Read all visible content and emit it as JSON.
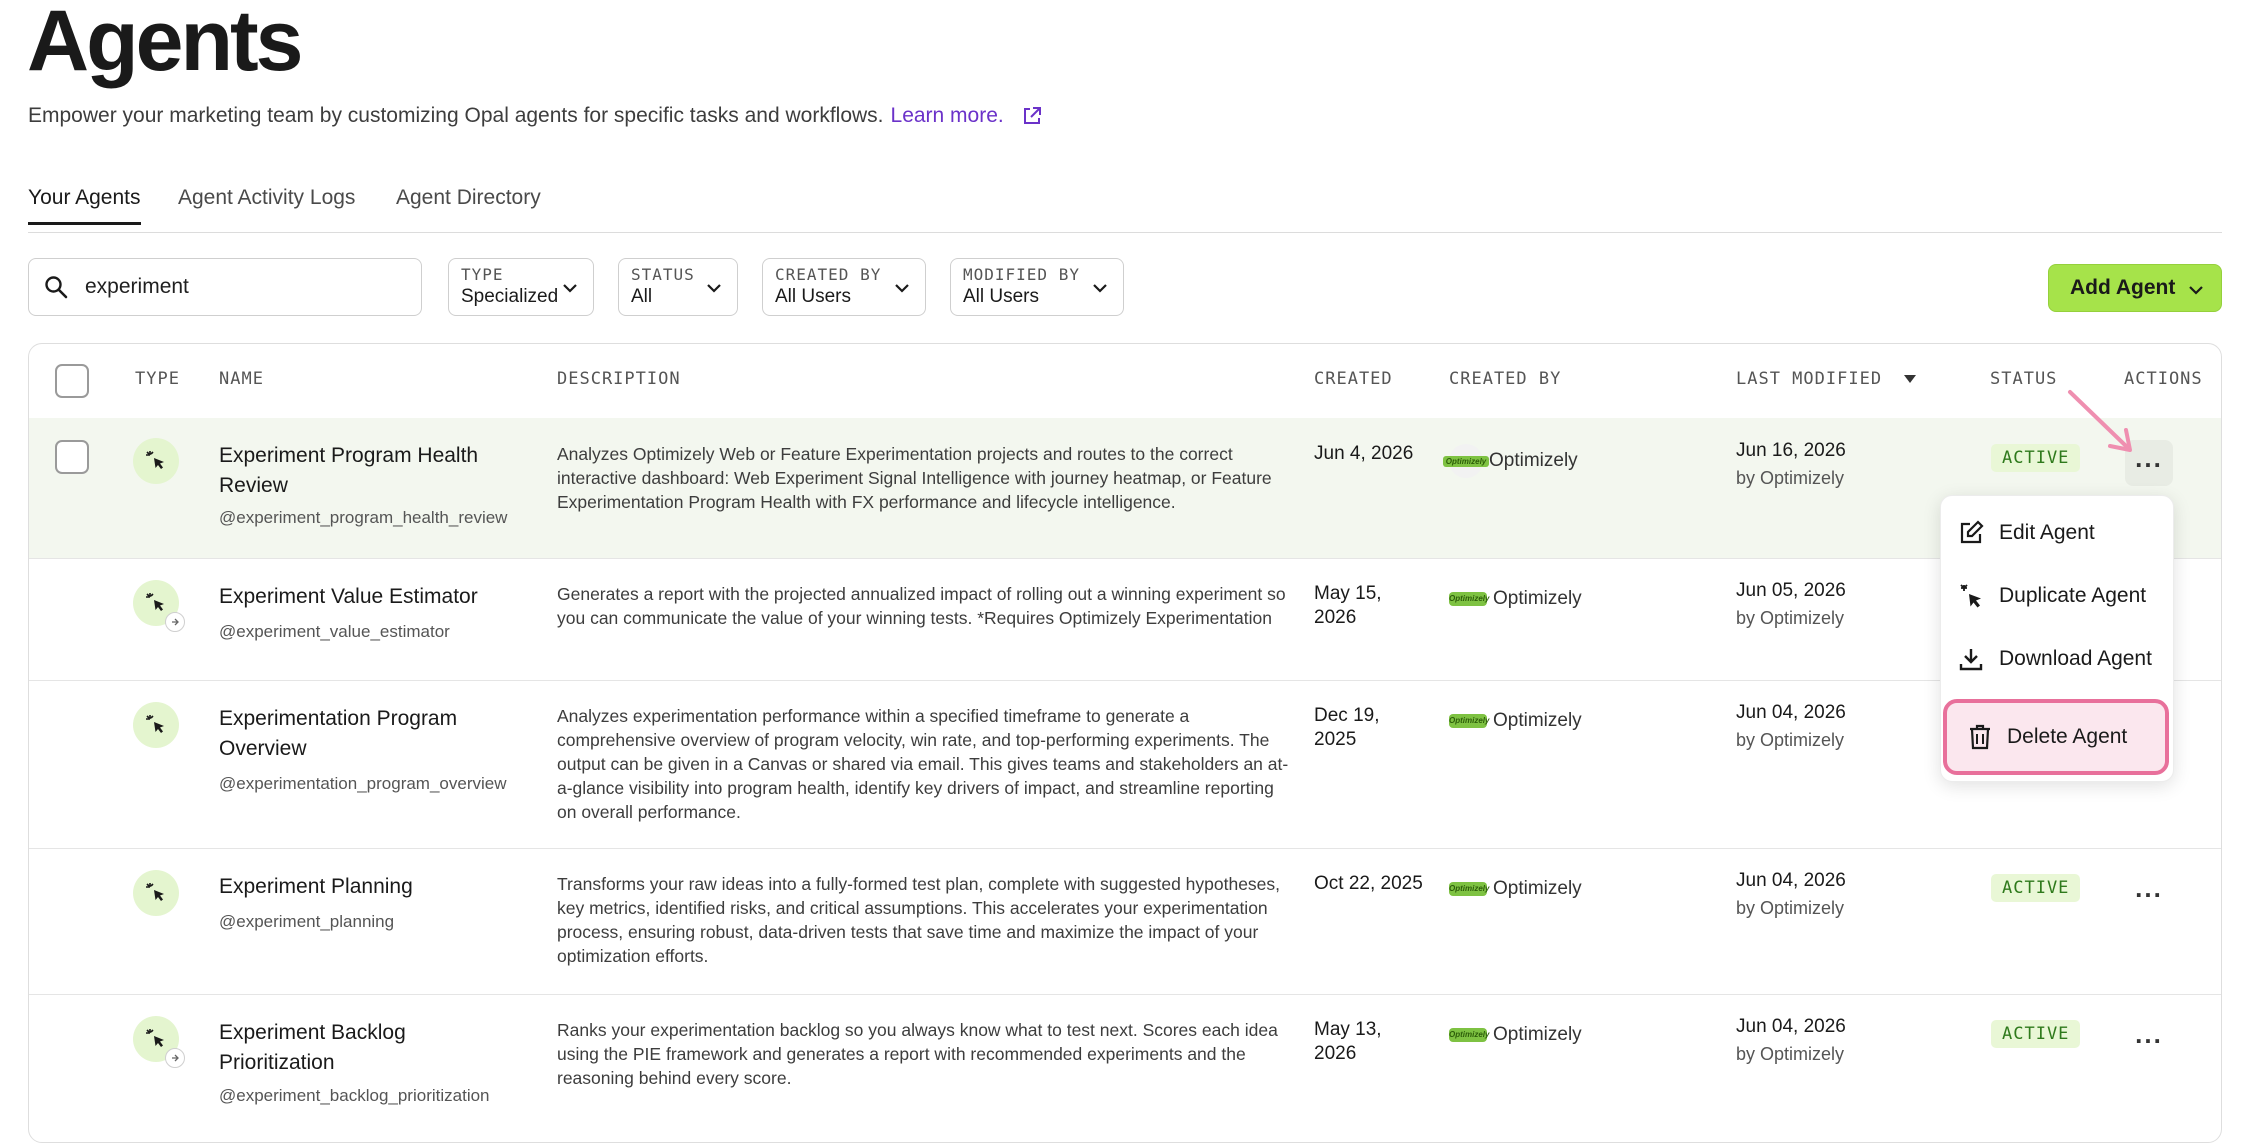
{
  "page": {
    "title": "Agents",
    "subtitle": "Empower your marketing team by customizing Opal agents for specific tasks and workflows.",
    "learn_more": "Learn more."
  },
  "tabs": [
    {
      "label": "Your Agents",
      "active": true
    },
    {
      "label": "Agent Activity Logs",
      "active": false
    },
    {
      "label": "Agent Directory",
      "active": false
    }
  ],
  "search": {
    "value": "experiment"
  },
  "filters": [
    {
      "label": "TYPE",
      "value": "Specialized"
    },
    {
      "label": "STATUS",
      "value": "All"
    },
    {
      "label": "CREATED BY",
      "value": "All Users"
    },
    {
      "label": "MODIFIED BY",
      "value": "All Users"
    }
  ],
  "add_agent": {
    "label": "Add Agent"
  },
  "table": {
    "headers": {
      "type": "TYPE",
      "name": "NAME",
      "description": "DESCRIPTION",
      "created": "CREATED",
      "created_by": "CREATED BY",
      "last_modified": "LAST MODIFIED",
      "status": "STATUS",
      "actions": "ACTIONS"
    },
    "rows": [
      {
        "name": "Experiment Program Health Review",
        "handle": "@experiment_program_health_review",
        "description": "Analyzes Optimizely Web or Feature Experimentation projects and routes to the correct interactive dashboard: Web Experiment Signal Intelligence with journey heatmap, or Feature Experimentation Program Health with FX performance and lifecycle intelligence.",
        "created": "Jun 4, 2026",
        "created_by": "Optimizely",
        "modified": "Jun 16, 2026",
        "modified_by": "by Optimizely",
        "status": "ACTIVE"
      },
      {
        "name": "Experiment Value Estimator",
        "handle": "@experiment_value_estimator",
        "description": "Generates a report with the projected annualized impact of rolling out a winning experiment so you can communicate the value of your winning tests. *Requires Optimizely Experimentation",
        "created": "May 15, 2026",
        "created_by": "Optimizely",
        "modified": "Jun 05, 2026",
        "modified_by": "by Optimizely",
        "status": ""
      },
      {
        "name": "Experimentation Program Overview",
        "handle": "@experimentation_program_overview",
        "description": "Analyzes experimentation performance within a specified timeframe to generate a comprehensive overview of program velocity, win rate, and top-performing experiments. The output can be given in a Canvas or shared via email. This gives teams and stakeholders an at-a-glance visibility into program health, identify key drivers of impact, and streamline reporting on overall performance.",
        "created": "Dec 19, 2025",
        "created_by": "Optimizely",
        "modified": "Jun 04, 2026",
        "modified_by": "by Optimizely",
        "status": ""
      },
      {
        "name": "Experiment Planning",
        "handle": "@experiment_planning",
        "description": "Transforms your raw ideas into a fully-formed test plan, complete with suggested hypotheses, key metrics, identified risks, and critical assumptions. This accelerates your experimentation process, ensuring robust, data-driven tests that save time and maximize the impact of your optimization efforts.",
        "created": "Oct 22, 2025",
        "created_by": "Optimizely",
        "modified": "Jun 04, 2026",
        "modified_by": "by Optimizely",
        "status": "ACTIVE"
      },
      {
        "name": "Experiment Backlog Prioritization",
        "handle": "@experiment_backlog_prioritization",
        "description": "Ranks your experimentation backlog so you always know what to test next. Scores each idea using the PIE framework and generates a report with recommended experiments and the reasoning behind every score.",
        "created": "May 13, 2026",
        "created_by": "Optimizely",
        "modified": "Jun 04, 2026",
        "modified_by": "by Optimizely",
        "status": "ACTIVE"
      }
    ]
  },
  "actions_menu": {
    "items": [
      "Edit Agent",
      "Duplicate Agent",
      "Download Agent"
    ],
    "delete": "Delete Agent"
  },
  "colors": {
    "accent_green": "#a6e34a",
    "link_purple": "#6b32c9",
    "highlight_pink": "#e8709b",
    "status_green": "#2f7a1c"
  },
  "icons": {
    "search": "search-icon",
    "external": "external-link-icon",
    "chevron": "chevron-down-icon",
    "agent_type": "cursor-sparkle-icon",
    "edit": "edit-icon",
    "duplicate": "duplicate-icon",
    "download": "download-icon",
    "delete": "trash-icon"
  }
}
